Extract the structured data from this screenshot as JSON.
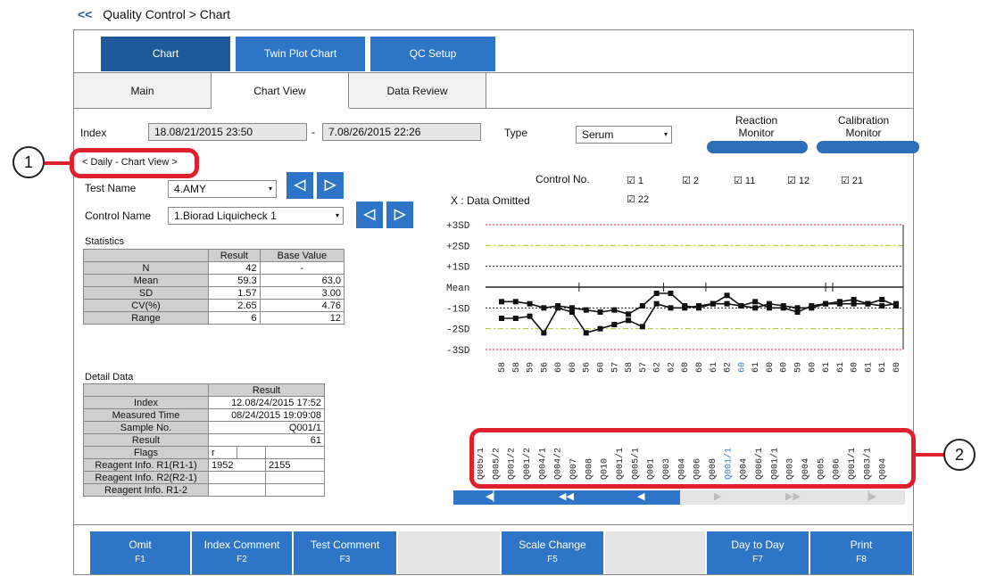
{
  "breadcrumb": {
    "back": "<<",
    "text": "Quality Control > Chart"
  },
  "top_tabs": [
    {
      "label": "Chart",
      "color": "#1e5a9a"
    },
    {
      "label": "Twin Plot Chart",
      "color": "#2e75c7"
    },
    {
      "label": "QC Setup",
      "color": "#2e75c7"
    }
  ],
  "sub_tabs": [
    "Main",
    "Chart View",
    "Data Review"
  ],
  "index": {
    "label": "Index",
    "from": "18.08/21/2015 23:50",
    "sep": "-",
    "to": "7.08/26/2015 22:26"
  },
  "type": {
    "label": "Type",
    "value": "Serum"
  },
  "monitors": {
    "reaction": "Reaction\nMonitor",
    "calibration": "Calibration\nMonitor"
  },
  "view_title": "< Daily - Chart View >",
  "test_name": {
    "label": "Test Name",
    "value": "4.AMY"
  },
  "control_name": {
    "label": "Control Name",
    "value": "1.Biorad Liquicheck 1"
  },
  "statistics": {
    "title": "Statistics",
    "headers": [
      "",
      "Result",
      "Base Value"
    ],
    "rows": [
      [
        "N",
        "42",
        "-"
      ],
      [
        "Mean",
        "59.3",
        "63.0"
      ],
      [
        "SD",
        "1.57",
        "3.00"
      ],
      [
        "CV(%)",
        "2.65",
        "4.76"
      ],
      [
        "Range",
        "6",
        "12"
      ]
    ]
  },
  "detail": {
    "title": "Detail Data",
    "header": "Result",
    "rows": [
      [
        "Index",
        "12.08/24/2015 17:52"
      ],
      [
        "Measured Time",
        "08/24/2015 19:09:08"
      ],
      [
        "Sample No.",
        "Q001/1"
      ],
      [
        "Result",
        "61"
      ],
      [
        "Flags",
        "r"
      ],
      [
        "Reagent Info. R1(R1-1)",
        "1952",
        "2155"
      ],
      [
        "Reagent Info. R2(R2-1)",
        ""
      ],
      [
        "Reagent Info. R1-2",
        ""
      ]
    ]
  },
  "control_no": {
    "label": "Control No.",
    "items": [
      "1",
      "2",
      "11",
      "12",
      "21",
      "22"
    ],
    "omitted_label": "X : Data Omitted"
  },
  "chart_data": {
    "type": "line",
    "y_ticks": [
      "+3SD",
      "+2SD",
      "+1SD",
      "Mean",
      "-1SD",
      "-2SD",
      "-3SD"
    ],
    "ylim": [
      -3,
      3
    ],
    "x_values": [
      "58",
      "58",
      "59",
      "56",
      "60",
      "60",
      "56",
      "60",
      "57",
      "58",
      "57",
      "62",
      "62",
      "60",
      "60",
      "61",
      "62",
      "60",
      "61",
      "60",
      "60",
      "59",
      "60",
      "61",
      "61",
      "60",
      "61",
      "61",
      "60"
    ],
    "sample_labels": [
      "Q005/1",
      "Q005/2",
      "Q001/2",
      "Q001/2",
      "Q004/1",
      "Q004/2",
      "Q007",
      "Q008",
      "Q010",
      "Q001/1",
      "Q005/1",
      "Q001",
      "Q003",
      "Q004",
      "Q006",
      "Q008",
      "Q001/1",
      "Q004",
      "Q006/1",
      "Q001/1",
      "Q003",
      "Q004",
      "Q005",
      "Q006",
      "Q001/1",
      "Q003/1",
      "Q004"
    ],
    "series": [
      {
        "values": [
          -0.7,
          -0.7,
          -0.8,
          -1.0,
          -0.9,
          -1.0,
          -1.1,
          -1.2,
          -1.1,
          -1.3,
          -0.9,
          -0.3,
          -0.3,
          -0.9,
          -1.0,
          -0.8,
          -0.4,
          -0.9,
          -1.0,
          -0.8,
          -0.9,
          -1.0,
          -1.0,
          -0.8,
          -0.7,
          -0.6,
          -0.8,
          -0.6,
          -0.9
        ]
      },
      {
        "values": [
          -1.5,
          -1.5,
          -1.4,
          -2.2,
          -1.0,
          -1.2,
          -2.2,
          -2.0,
          -1.8,
          -1.6,
          -1.9,
          -0.8,
          -1.0,
          -1.0,
          -0.9,
          -0.8,
          -0.8,
          -0.9,
          -0.7,
          -1.0,
          -1.0,
          -1.2,
          -0.9,
          -0.8,
          -0.8,
          -0.8,
          -0.8,
          -0.9,
          -0.8
        ]
      }
    ],
    "highlight_index": 17
  },
  "highlight_x_label_color": "#3a78c2",
  "callouts": [
    "1",
    "2"
  ],
  "bottom_buttons": [
    {
      "label": "Omit",
      "key": "F1"
    },
    {
      "label": "Index Comment",
      "key": "F2"
    },
    {
      "label": "Test Comment",
      "key": "F3"
    },
    {
      "label": "",
      "key": ""
    },
    {
      "label": "Scale Change",
      "key": "F5"
    },
    {
      "label": "",
      "key": ""
    },
    {
      "label": "Day to Day",
      "key": "F7"
    },
    {
      "label": "Print",
      "key": "F8"
    }
  ],
  "colors": {
    "accent": "#2e75c7",
    "dark_accent": "#1e5a9a",
    "highlight": "#e0202c",
    "plus3": "#e0202c",
    "plus2": "#a8c61f"
  }
}
